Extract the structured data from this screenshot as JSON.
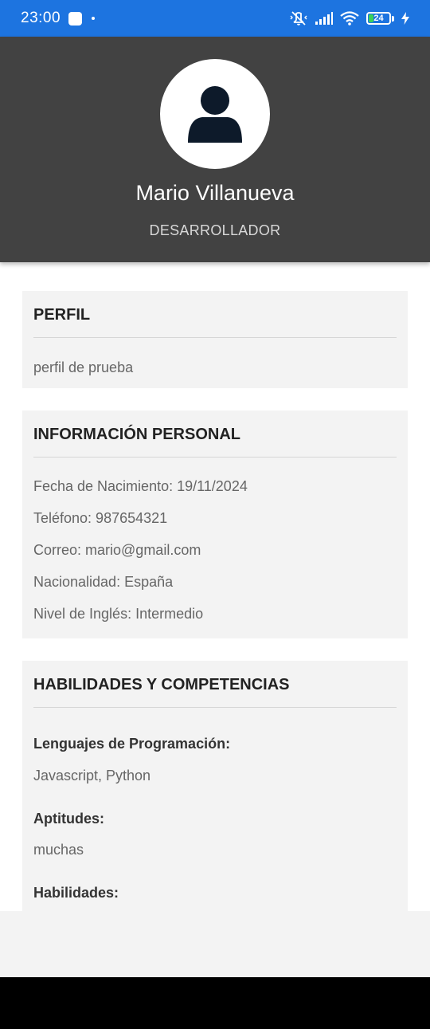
{
  "status_bar": {
    "time": "23:00",
    "battery": "24",
    "icons": [
      "notification-square-icon",
      "dot-icon",
      "mute-vibrate-icon",
      "signal-icon",
      "wifi-icon",
      "battery-icon",
      "charging-bolt-icon"
    ]
  },
  "profile": {
    "name": "Mario Villanueva",
    "role": "DESARROLLADOR",
    "avatar_icon": "user-silhouette-icon"
  },
  "perfil": {
    "title": "PERFIL",
    "text": "perfil de prueba"
  },
  "personal": {
    "title": "INFORMACIÓN PERSONAL",
    "birth": "Fecha de Nacimiento: 19/11/2024",
    "phone": "Teléfono: 987654321",
    "email": "Correo: mario@gmail.com",
    "nationality": "Nacionalidad: España",
    "english": "Nivel de Inglés: Intermedio"
  },
  "skills": {
    "title": "HABILIDADES Y COMPETENCIAS",
    "languages_label": "Lenguajes de Programación:",
    "languages_value": "Javascript, Python",
    "aptitudes_label": "Aptitudes:",
    "aptitudes_value": "muchas",
    "abilities_label": "Habilidades:"
  },
  "colors": {
    "status_bar": "#1d74e0",
    "header": "#424242",
    "card": "#f3f3f3"
  }
}
